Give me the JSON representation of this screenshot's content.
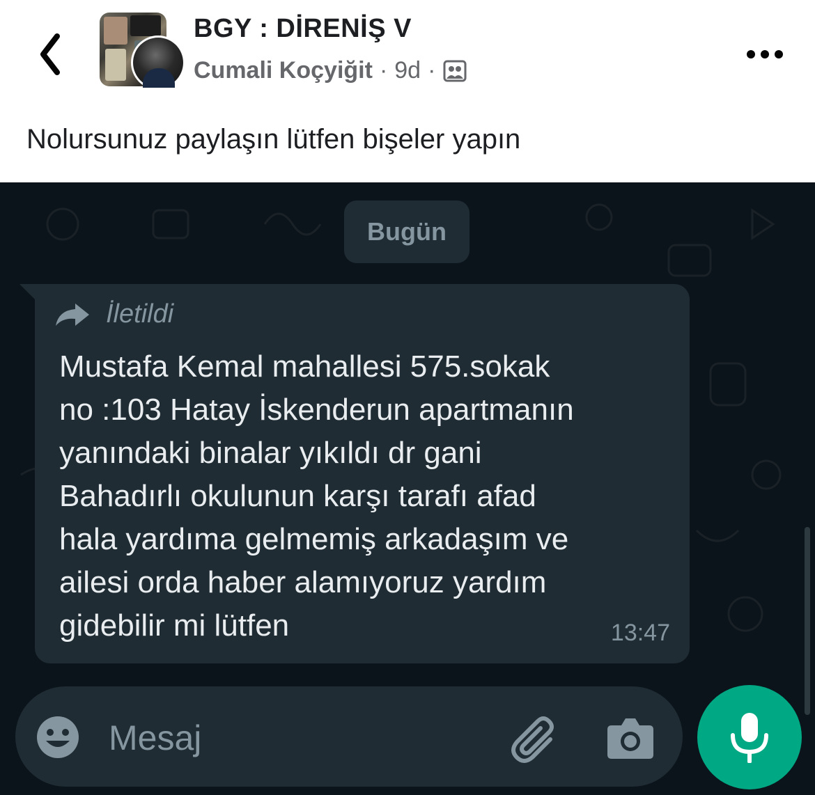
{
  "post": {
    "group_name": "BGY : DİRENİŞ V",
    "author": "Cumali Koçyiğit",
    "separator": "·",
    "time_ago": "9d",
    "text": "Nolursunuz paylaşın lütfen bişeler yapın"
  },
  "icons": {
    "back": "chevron-left-icon",
    "more": "more-horizontal-icon",
    "group_privacy": "group-members-icon",
    "forwarded": "forward-arrow-icon",
    "emoji": "emoji-icon",
    "attach": "paperclip-icon",
    "camera": "camera-icon",
    "mic": "microphone-icon"
  },
  "chat": {
    "date_chip": "Bugün",
    "forwarded_label": "İletildi",
    "message_lines": [
      "Mustafa Kemal mahallesi 575.sokak",
      "no :103 Hatay İskenderun apartmanın",
      "yanındaki binalar yıkıldı dr gani",
      "Bahadırlı okulunun karşı tarafı  afad",
      "hala yardıma gelmemiş arkadaşım ve",
      "ailesi orda haber alamıyoruz yardım",
      "gidebilir mi lütfen"
    ],
    "time": "13:47",
    "input_placeholder": "Mesaj"
  },
  "colors": {
    "chat_background": "#0b141a",
    "bubble": "#1f2c33",
    "mic_button": "#00a884",
    "meta_text": "#8696a0"
  }
}
